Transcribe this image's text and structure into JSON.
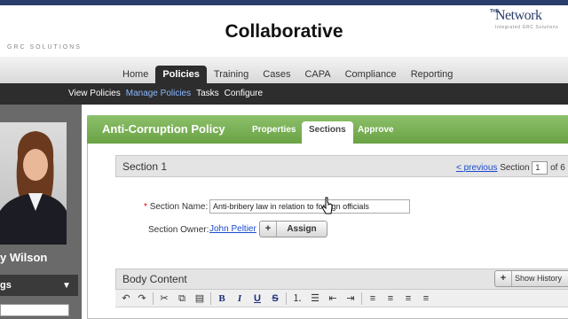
{
  "overlay": {
    "title": "Collaborative"
  },
  "logo": {
    "the": "THE",
    "name": "Network",
    "tagline": "Integrated GRC Solutions"
  },
  "nav": {
    "tabs": [
      {
        "label": "Home"
      },
      {
        "label": "Policies",
        "active": true
      },
      {
        "label": "Training"
      },
      {
        "label": "Cases"
      },
      {
        "label": "CAPA"
      },
      {
        "label": "Compliance"
      },
      {
        "label": "Reporting"
      }
    ],
    "subnav": [
      {
        "label": "View Policies"
      },
      {
        "label": "Manage Policies",
        "active": true
      },
      {
        "label": "Tasks"
      },
      {
        "label": "Configure"
      }
    ]
  },
  "sidebar": {
    "user_name": "y Wilson",
    "box_label": "gs"
  },
  "policy": {
    "title": "Anti-Corruption Policy",
    "tabs": [
      {
        "label": "Properties"
      },
      {
        "label": "Sections",
        "active": true
      },
      {
        "label": "Approve"
      }
    ]
  },
  "section": {
    "title": "Section 1",
    "pager": {
      "previous": "< previous",
      "section_label": "Section",
      "current": "1",
      "of": "of 6"
    },
    "name_label": "Section Name:",
    "name_required": "*",
    "name_value": "Anti-bribery law in relation to foreign officials",
    "owner_label": "Section Owner:",
    "owner_value": "John Peltier",
    "assign_plus": "+",
    "assign_label": "Assign"
  },
  "body": {
    "title": "Body Content",
    "history_plus": "+",
    "history_label": "Show History"
  },
  "toolbar": {
    "undo": "↶",
    "redo": "↷",
    "cut": "✂",
    "copy": "⧉",
    "paste": "▤",
    "bold": "B",
    "italic": "I",
    "underline": "U",
    "strike": "S",
    "ol": "⒈",
    "ul": "☰",
    "outdent": "⇤",
    "indent": "⇥",
    "align_left": "≡",
    "align_center": "≡",
    "align_right": "≡",
    "justify": "≡"
  },
  "colors": {
    "nav_dark": "#2d2d2d",
    "policy_green": "#7ab356",
    "link_blue": "#1a4bd0",
    "brand_navy": "#2a3e6c"
  }
}
